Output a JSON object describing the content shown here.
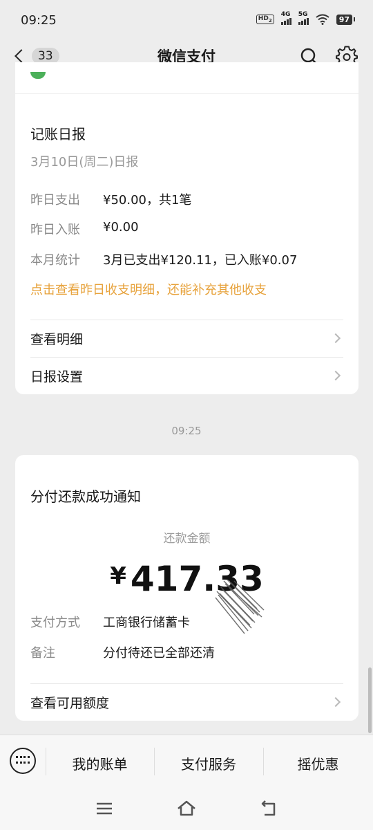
{
  "status_bar": {
    "time": "09:25",
    "hd": "HD",
    "hd_sub": "2",
    "net1": "4G",
    "net2": "5G",
    "battery": "97"
  },
  "nav": {
    "unread_count": "33",
    "title": "微信支付"
  },
  "daily_report": {
    "title": "记账日报",
    "date": "3月10日(周二)日报",
    "rows": [
      {
        "label": "昨日支出",
        "value": "¥50.00，共1笔"
      },
      {
        "label": "昨日入账",
        "value": "¥0.00"
      },
      {
        "label": "本月统计",
        "value": "3月已支出¥120.11，已入账¥0.07"
      }
    ],
    "hint": "点击查看昨日收支明细，还能补充其他收支",
    "link_details": "查看明细",
    "link_settings": "日报设置"
  },
  "timestamp": "09:25",
  "repay_notice": {
    "title": "分付还款成功通知",
    "amount_label": "还款金额",
    "currency": "¥",
    "amount": "417.33",
    "rows": [
      {
        "label": "支付方式",
        "value": "工商银行储蓄卡"
      },
      {
        "label": "备注",
        "value": "分付待还已全部还清"
      }
    ],
    "link_quota": "查看可用额度"
  },
  "bottom_menu": {
    "items": [
      "我的账单",
      "支付服务",
      "摇优惠"
    ]
  },
  "colors": {
    "accent_orange": "#e7a23b",
    "background": "#ededed"
  }
}
